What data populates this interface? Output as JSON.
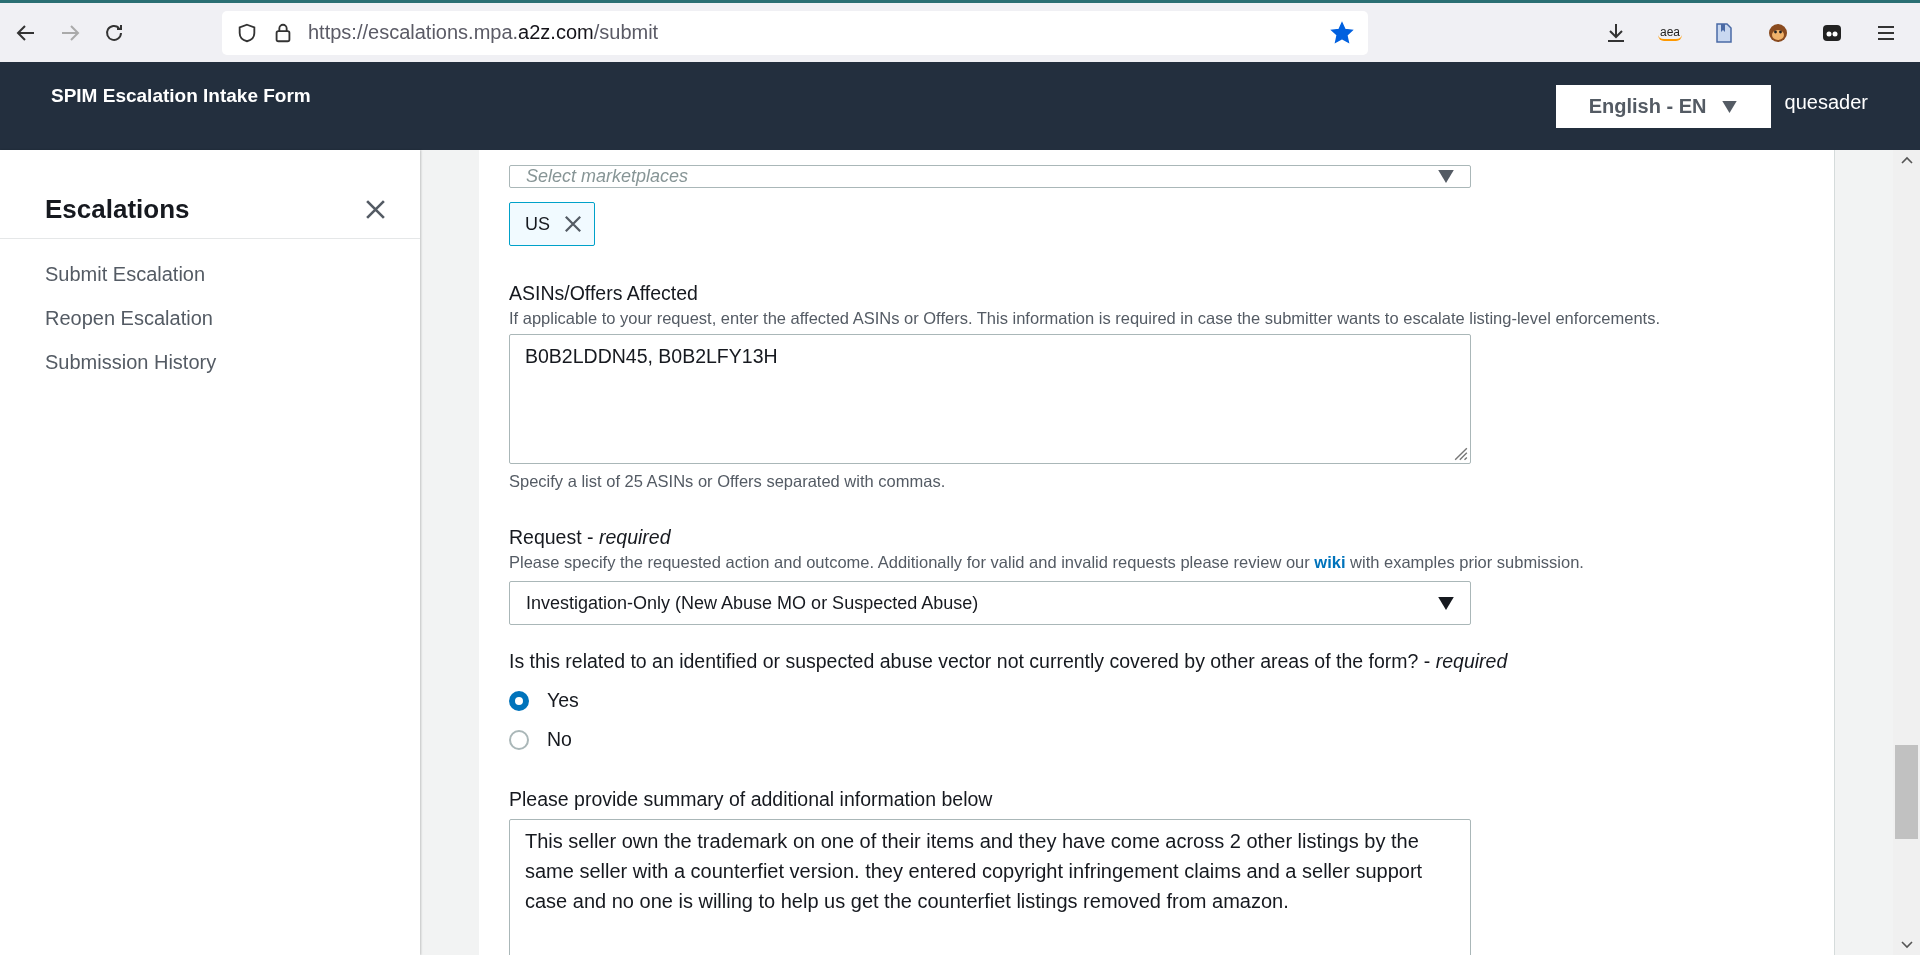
{
  "browser": {
    "url": {
      "prefix": "https://escalations.mpa.",
      "domain": "a2z.com",
      "path": "/submit"
    },
    "bookmarked": true,
    "forward_disabled": true,
    "extension_text": "aea"
  },
  "header": {
    "title": "SPIM Escalation Intake Form",
    "language": "English - EN",
    "user": "quesader"
  },
  "sidebar": {
    "title": "Escalations",
    "items": [
      {
        "label": "Submit Escalation"
      },
      {
        "label": "Reopen Escalation"
      },
      {
        "label": "Submission History"
      }
    ]
  },
  "form": {
    "marketplaces": {
      "placeholder": "Select marketplaces",
      "tokens": [
        "US"
      ]
    },
    "asins": {
      "label": "ASINs/Offers Affected",
      "description": "If applicable to your request, enter the affected ASINs or Offers. This information is required in case the submitter wants to escalate listing-level enforcements.",
      "value": "B0B2LDDN45, B0B2LFY13H",
      "hint": "Specify a list of 25 ASINs or Offers separated with commas."
    },
    "request": {
      "label": "Request - *required*",
      "description_before": "Please specify the requested action and outcome. Additionally for valid and invalid requests please review our",
      "link": "wiki",
      "description_after": "with examples prior submission.",
      "value": "Investigation-Only (New Abuse MO or Suspected Abuse)"
    },
    "abuse_vector": {
      "label": "Is this related to an identified or suspected abuse vector not currently covered by other areas of the form? - *required*",
      "options": [
        {
          "label": "Yes",
          "selected": true
        },
        {
          "label": "No",
          "selected": false
        }
      ]
    },
    "summary": {
      "label": "Please provide summary of additional information below",
      "value": "This seller own the trademark on one of their items and they have come across 2 other listings by the same seller with a counterfiet version. they entered copyright infringement claims and a seller support case and no one is willing to help us get the counterfiet listings removed from amazon."
    }
  }
}
